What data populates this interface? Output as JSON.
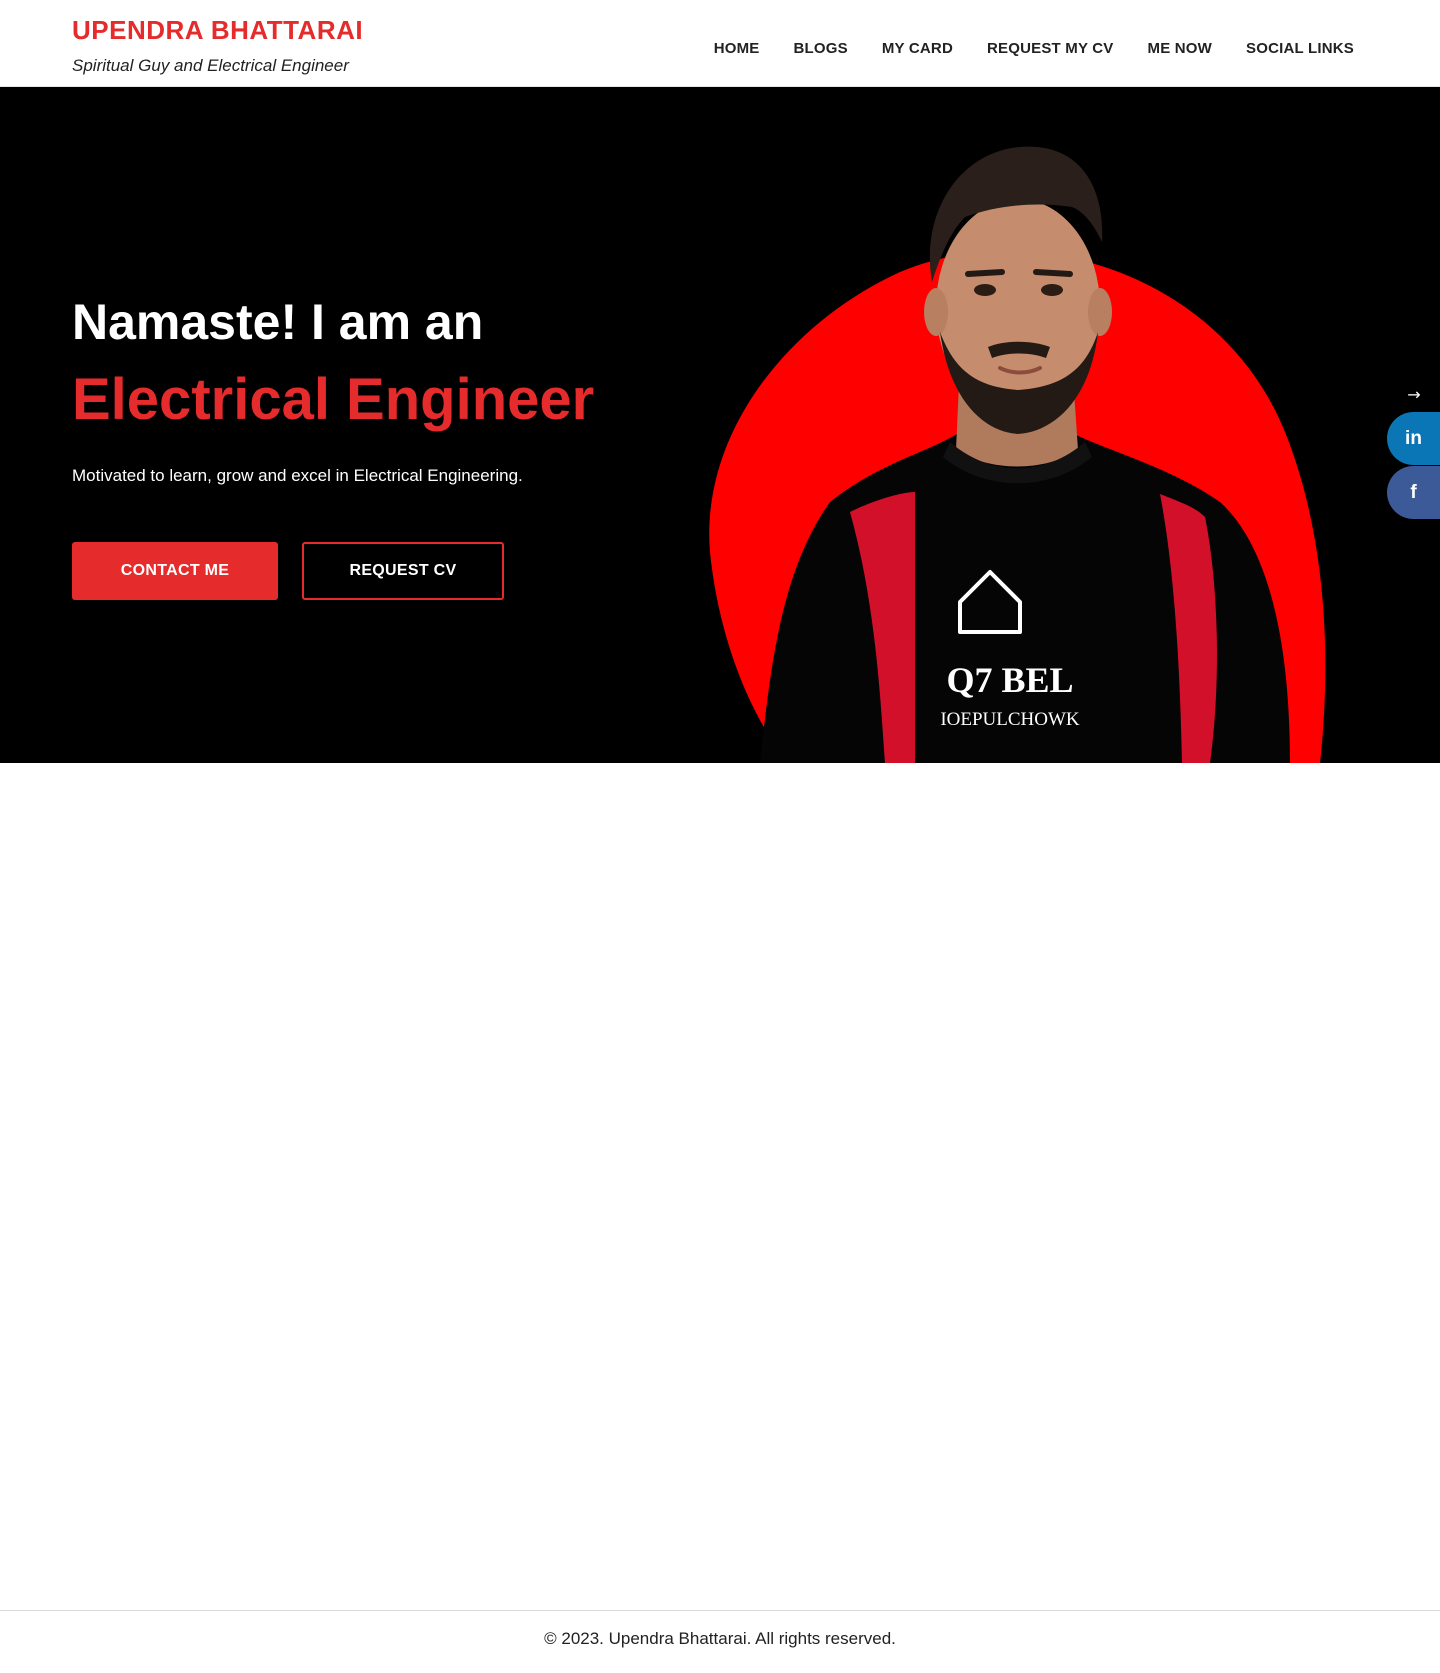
{
  "header": {
    "brand_name": "UPENDRA BHATTARAI",
    "tagline": "Spiritual Guy and Electrical Engineer",
    "nav": [
      {
        "label": "HOME"
      },
      {
        "label": "BLOGS"
      },
      {
        "label": "MY CARD"
      },
      {
        "label": "REQUEST MY CV"
      },
      {
        "label": "ME NOW"
      },
      {
        "label": "SOCIAL LINKS"
      }
    ]
  },
  "hero": {
    "greeting": "Namaste! I am an",
    "role": "Electrical Engineer",
    "description": "Motivated to learn, grow and excel in Electrical Engineering.",
    "primary_button": "CONTACT ME",
    "secondary_button": "REQUEST CV",
    "shirt_text_top": "Q7 BEL",
    "shirt_text_bottom": "IOEPULCHOWK"
  },
  "floating_social": {
    "toggle_icon": "arrow-right-icon",
    "toggle_glyph": "→",
    "linkedin_glyph": "in",
    "facebook_glyph": "f"
  },
  "colors": {
    "accent": "#e52b2b",
    "hero_bg": "#000000",
    "linkedin": "#0a76b6",
    "facebook": "#3d5a98"
  },
  "footer": {
    "text": "© 2023. Upendra Bhattarai. All rights reserved."
  }
}
